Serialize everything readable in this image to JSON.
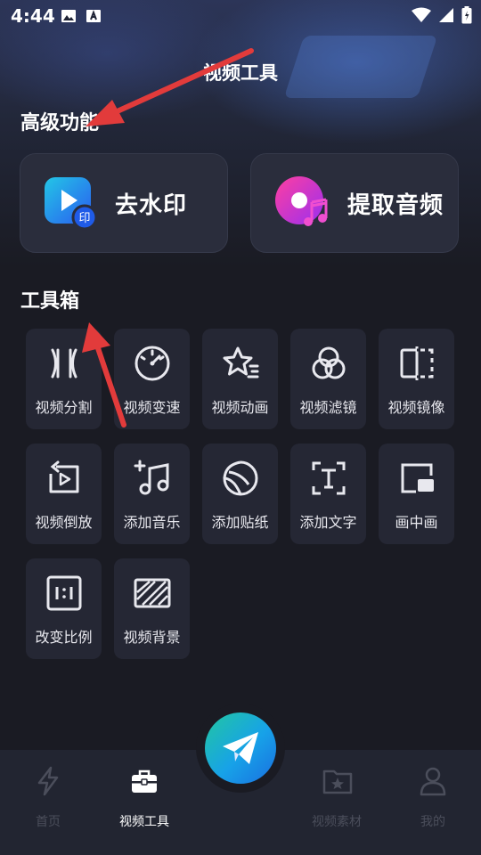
{
  "status_bar": {
    "time": "4:44"
  },
  "header": {
    "title": "视频工具"
  },
  "premium": {
    "title": "高级功能",
    "cards": [
      {
        "label": "去水印",
        "icon": "watermark-remove-icon"
      },
      {
        "label": "提取音频",
        "icon": "audio-extract-icon"
      }
    ]
  },
  "toolbox": {
    "title": "工具箱",
    "items": [
      {
        "label": "视频分割",
        "icon": "split-icon"
      },
      {
        "label": "视频变速",
        "icon": "speed-gauge-icon"
      },
      {
        "label": "视频动画",
        "icon": "star-animation-icon"
      },
      {
        "label": "视频滤镜",
        "icon": "filter-icon"
      },
      {
        "label": "视频镜像",
        "icon": "mirror-icon"
      },
      {
        "label": "视频倒放",
        "icon": "reverse-play-icon"
      },
      {
        "label": "添加音乐",
        "icon": "music-add-icon"
      },
      {
        "label": "添加贴纸",
        "icon": "sticker-icon"
      },
      {
        "label": "添加文字",
        "icon": "text-icon"
      },
      {
        "label": "画中画",
        "icon": "picture-in-picture-icon"
      },
      {
        "label": "改变比例",
        "icon": "ratio-icon"
      },
      {
        "label": "视频背景",
        "icon": "background-icon"
      }
    ]
  },
  "bottom_nav": {
    "items": [
      {
        "label": "首页",
        "icon": "lightning-icon",
        "active": false
      },
      {
        "label": "视频工具",
        "icon": "toolbox-icon",
        "active": true
      },
      {
        "label": "视频素材",
        "icon": "folder-star-icon",
        "active": false
      },
      {
        "label": "我的",
        "icon": "user-icon",
        "active": false
      }
    ],
    "center_button_icon": "paper-plane-icon"
  },
  "colors": {
    "background": "#1a1b23",
    "card": "#2a2d3c",
    "tile": "#252734",
    "annotation_arrow": "#e23b3b",
    "fab_start": "#22c7a0",
    "fab_end": "#1a6ee0"
  }
}
